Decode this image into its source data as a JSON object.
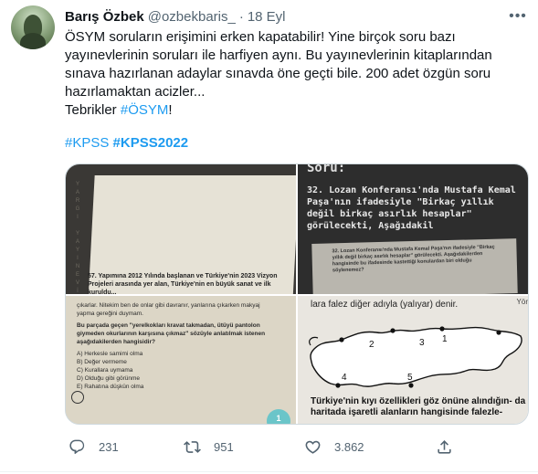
{
  "author": {
    "name": "Barış Özbek",
    "handle": "@ozbekbaris_",
    "separator": "·",
    "date": "18 Eyl"
  },
  "tweet": {
    "lines": [
      "ÖSYM soruların erişimini erken kapatabilir! Yine birçok soru bazı",
      "yayınevlerinin soruları ile harfiyen aynı.  Bu yayınevlerinin kitaplarından",
      "sınava hazırlanan adaylar sınavda öne geçti bile. 200 adet özgün soru",
      "hazırlamaktan acizler..."
    ],
    "congrats_prefix": "Tebrikler ",
    "congrats_hashtag": "#ÖSYM",
    "congrats_suffix": "!",
    "hashtags": [
      "#KPSS",
      "#KPSS2022"
    ]
  },
  "media": {
    "top_left": {
      "side_letters": [
        "Y",
        "A",
        "R",
        "G",
        "I",
        "",
        "Y",
        "A",
        "Y",
        "I",
        "N",
        "E",
        "V",
        "İ"
      ],
      "question": "57.  Yapımına 2012 Yılında başlanan ve Türkiye'nin 2023 Vizyon Projeleri arasında yer alan, Türkiye'nin en büyük sanat ve ilk kuruldu..."
    },
    "top_right": {
      "title": "Soru:",
      "question": "32. Lozan Konferansı'nda Mustafa Kemal Paşa'nın ifadesiyle \"Birkaç yıllık değil birkaç asırlık hesaplar\" görülecekti, Aşağıdakil",
      "photo_text": "32. Lozan Konferansı'nda Mustafa Kemal Paşa'nın ifadesiyle \"Birkaç yıllık değil birkaç asırlık hesaplar\" görülecekti. Aşağıdakilerden hangisinde bu ifadesinde kastettiği konulardan biri olduğu söylenemez?"
    },
    "bottom_left": {
      "intro": "çıkarlar. Nitekim ben de onlar gibi davranır, yanlarına çıkarken makyaj yapma gereğini duymam.",
      "question": "Bu parçada geçen \"yerelkokları kravat takmadan, ütüyü pantolon giymeden okurlarının karşısına çıkmaz\" sözüyle anlatılmak istenen aşağıdakilerden hangisidir?",
      "options": [
        "A)  Herkesle samimi olma",
        "B)  Değer vermeme",
        "C)  Kurallara uymama",
        "D)  Olduğu gibi görünme",
        "E)  Rahatına düşkün olma"
      ],
      "stamp": "1"
    },
    "bottom_right": {
      "top_text": "lara falez diğer adıyla (yalıyar) denir.",
      "side_text": "Yör",
      "map_labels": [
        "1",
        "2",
        "3",
        "4",
        "5"
      ],
      "bottom_text": "Türkiye'nin kıyı özellikleri göz önüne alındığın- da haritada işaretli alanların hangisinde falezle-"
    }
  },
  "actions": {
    "replies": "231",
    "retweets": "951",
    "likes": "3.862"
  }
}
